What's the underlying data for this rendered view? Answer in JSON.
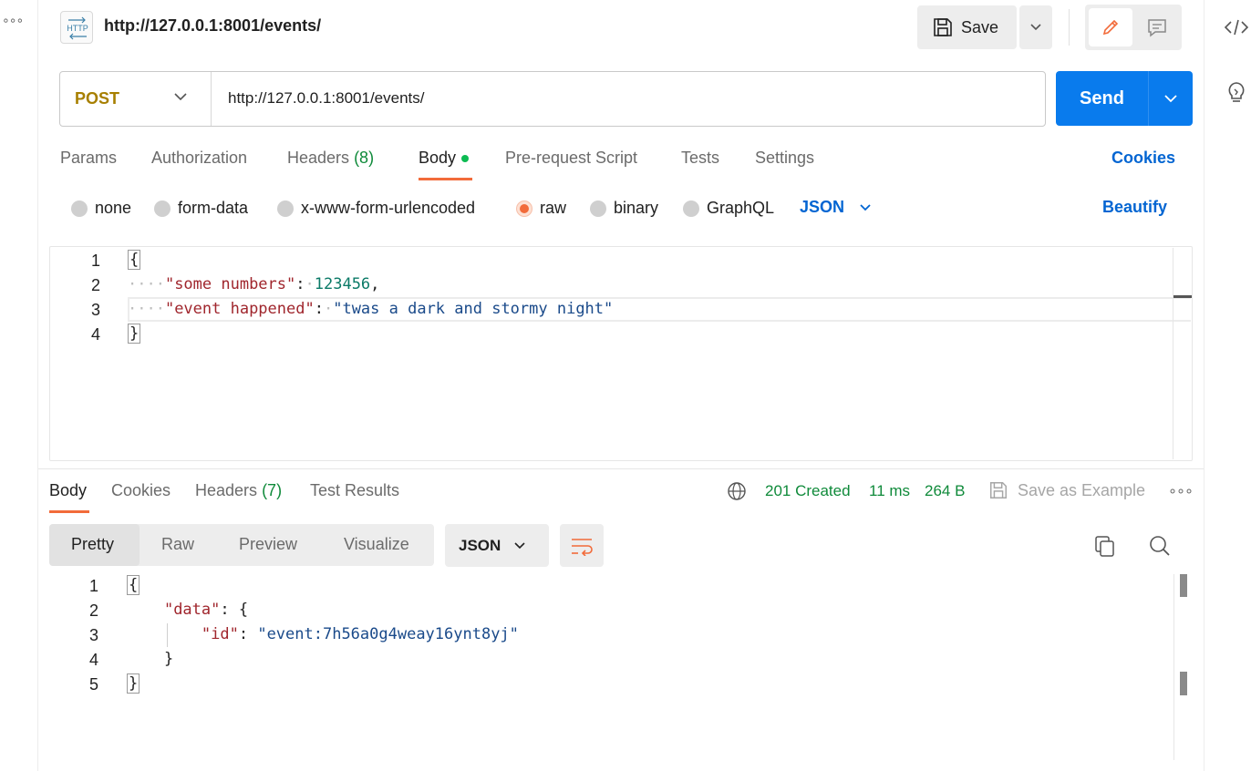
{
  "tab": {
    "title": "http://127.0.0.1:8001/events/",
    "icon": "http-request-icon"
  },
  "toolbar": {
    "save_label": "Save"
  },
  "request": {
    "method": "POST",
    "url": "http://127.0.0.1:8001/events/",
    "send_label": "Send"
  },
  "request_tabs": {
    "params": "Params",
    "authorization": "Authorization",
    "headers": "Headers",
    "headers_count": "(8)",
    "body": "Body",
    "prerequest": "Pre-request Script",
    "tests": "Tests",
    "settings": "Settings",
    "cookies": "Cookies"
  },
  "body_types": {
    "none": "none",
    "form_data": "form-data",
    "urlencoded": "x-www-form-urlencoded",
    "raw": "raw",
    "binary": "binary",
    "graphql": "GraphQL",
    "selected": "raw",
    "language": "JSON",
    "beautify": "Beautify"
  },
  "request_body": {
    "line_numbers": [
      "1",
      "2",
      "3",
      "4"
    ],
    "open_brace": "{",
    "close_brace": "}",
    "key1": "\"some numbers\"",
    "value1": "123456",
    "key2": "\"event happened\"",
    "value2": "\"twas a dark and stormy night\""
  },
  "response_tabs": {
    "body": "Body",
    "cookies": "Cookies",
    "headers": "Headers",
    "headers_count": "(7)",
    "test_results": "Test Results"
  },
  "response_meta": {
    "status": "201 Created",
    "time": "11 ms",
    "size": "264 B",
    "save_example": "Save as Example"
  },
  "response_view": {
    "pretty": "Pretty",
    "raw": "Raw",
    "preview": "Preview",
    "visualize": "Visualize",
    "language": "JSON"
  },
  "response_body": {
    "line_numbers": [
      "1",
      "2",
      "3",
      "4",
      "5"
    ],
    "open_brace": "{",
    "data_key": "\"data\"",
    "data_open": "{",
    "id_key": "\"id\"",
    "id_value": "\"event:7h56a0g4weay16ynt8yj\"",
    "data_close": "}",
    "close_brace": "}"
  },
  "colors": {
    "accent": "#f26b3a",
    "primary": "#097bed",
    "link": "#0265d2",
    "success": "#0f8a3a",
    "method_post": "#a77f00"
  }
}
